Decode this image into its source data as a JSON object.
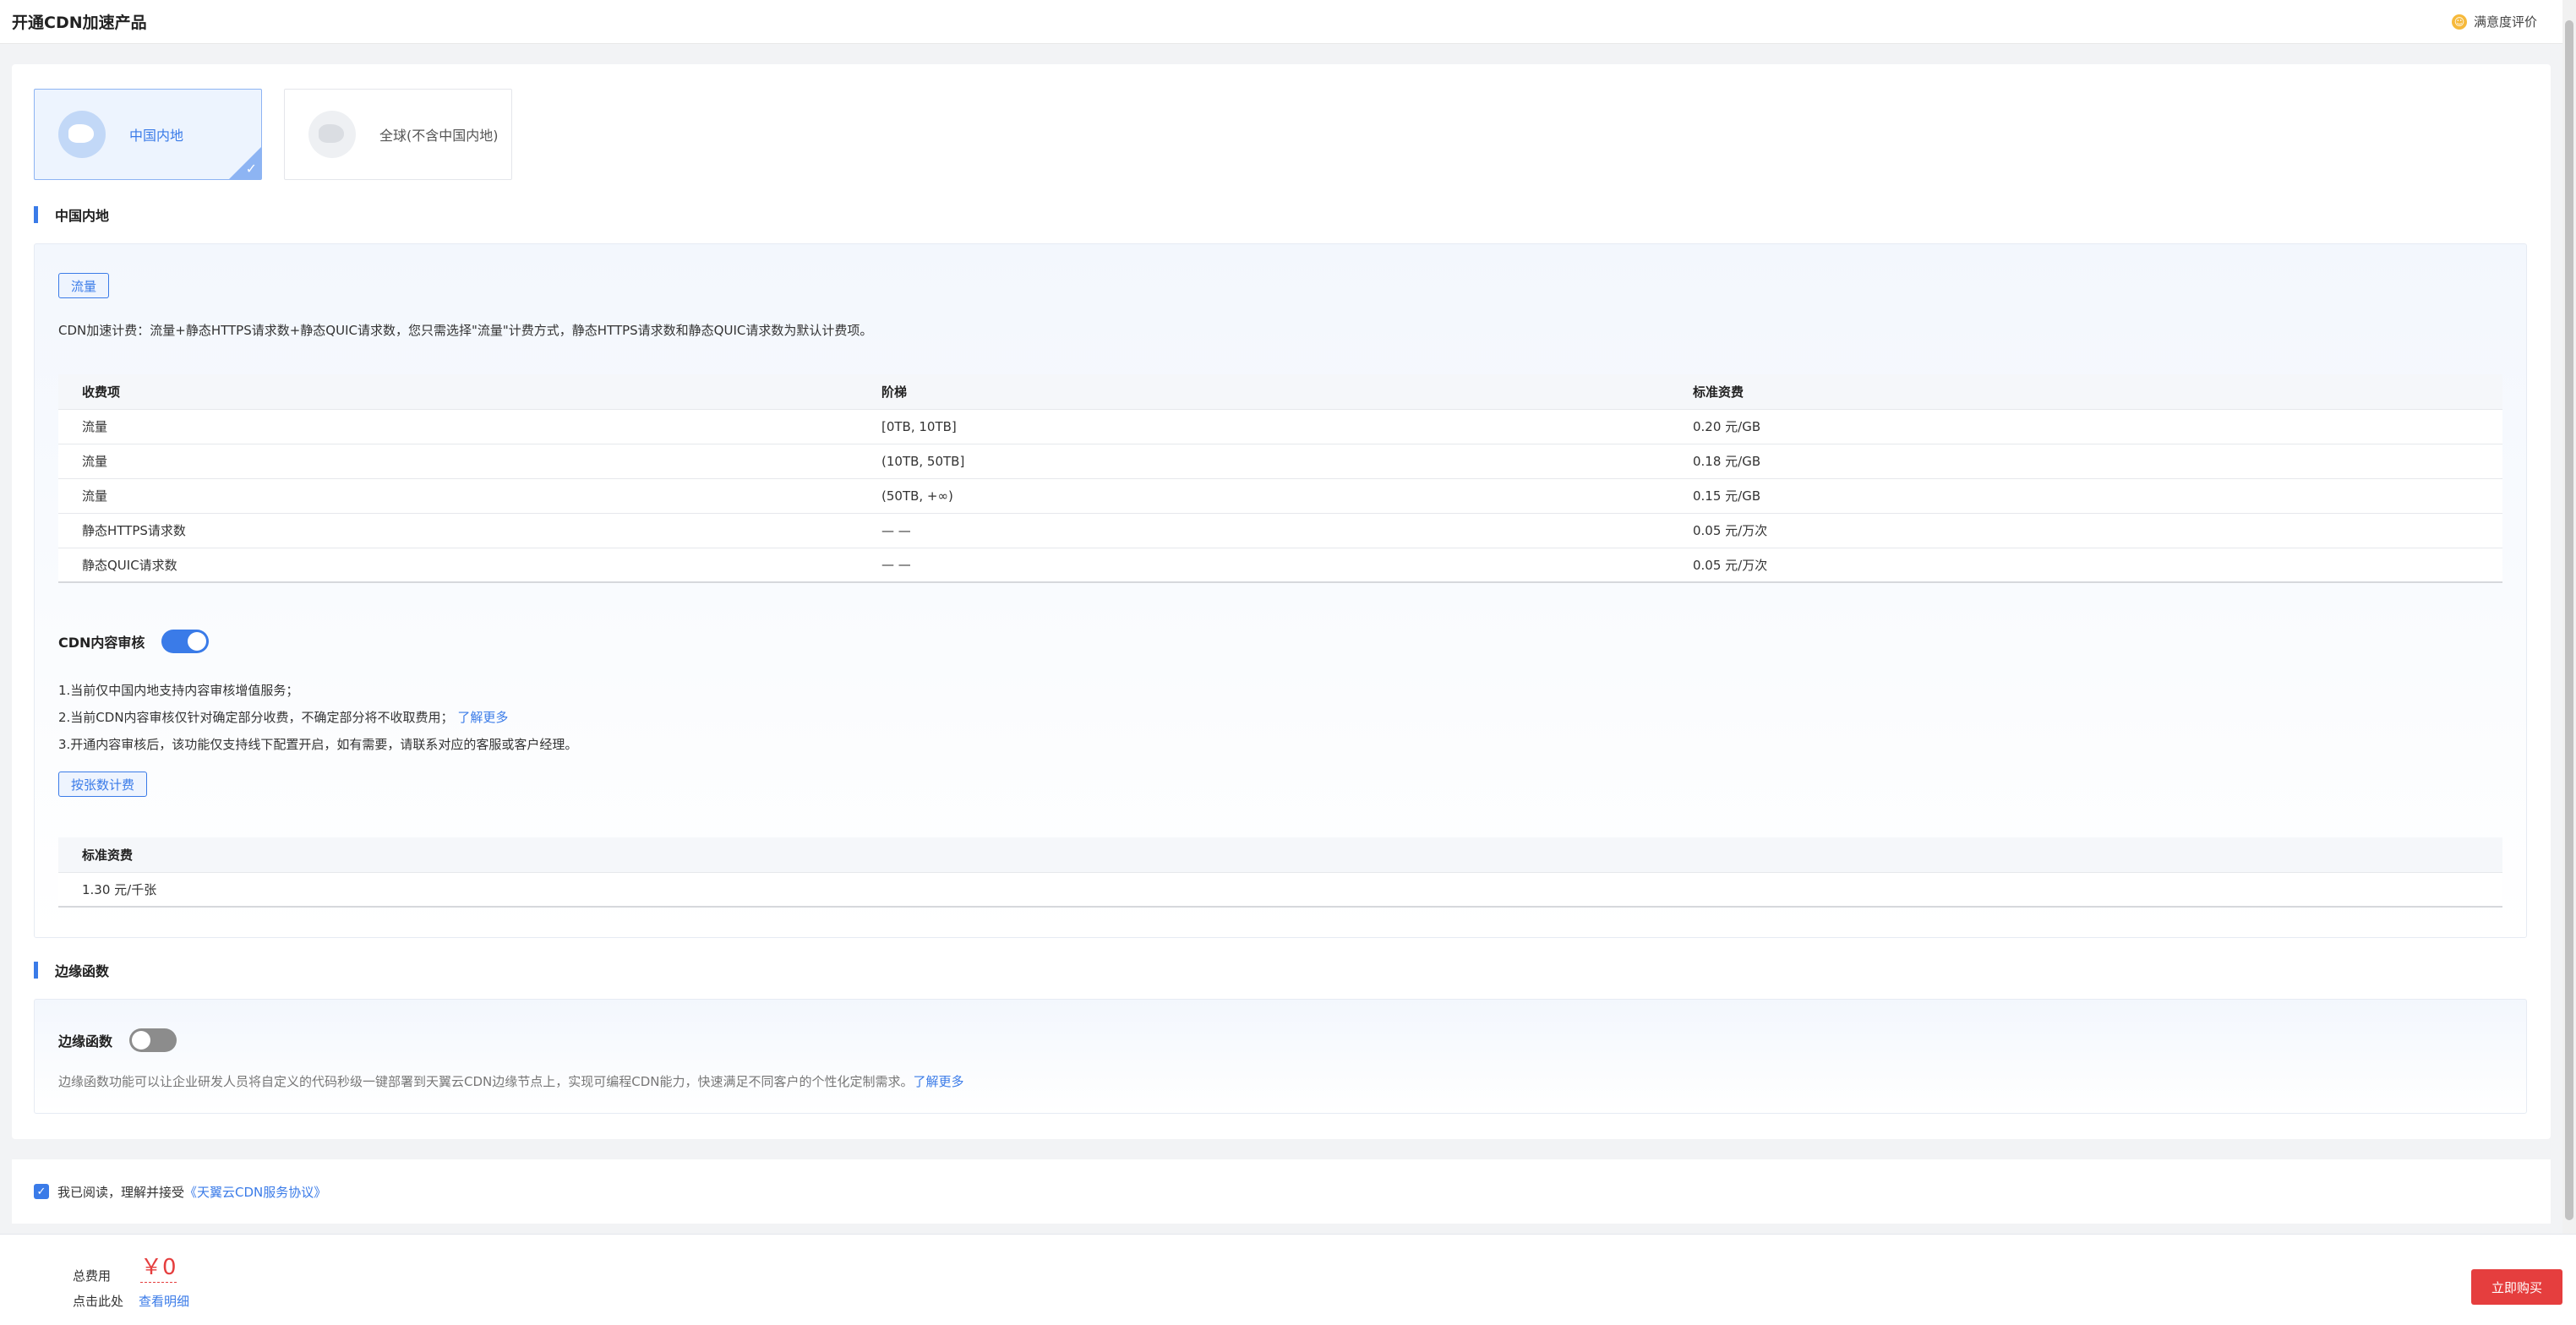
{
  "header": {
    "title": "开通CDN加速产品",
    "survey_label": "满意度评价",
    "survey_icon": "smile-icon"
  },
  "regions": [
    {
      "label": "中国内地",
      "selected": true,
      "icon": "china-map-icon"
    },
    {
      "label": "全球(不含中国内地)",
      "selected": false,
      "icon": "world-map-icon"
    }
  ],
  "mainland": {
    "heading": "中国内地",
    "billing_chip": "流量",
    "billing_desc": "CDN加速计费：流量+静态HTTPS请求数+静态QUIC请求数，您只需选择\"流量\"计费方式，静态HTTPS请求数和静态QUIC请求数为默认计费项。",
    "table": {
      "headers": [
        "收费项",
        "阶梯",
        "标准资费"
      ],
      "rows": [
        [
          "流量",
          "[0TB, 10TB]",
          "0.20 元/GB"
        ],
        [
          "流量",
          "(10TB, 50TB]",
          "0.18 元/GB"
        ],
        [
          "流量",
          "(50TB, +∞)",
          "0.15 元/GB"
        ],
        [
          "静态HTTPS请求数",
          "— —",
          "0.05 元/万次"
        ],
        [
          "静态QUIC请求数",
          "— —",
          "0.05 元/万次"
        ]
      ]
    },
    "audit": {
      "label": "CDN内容审核",
      "enabled": true,
      "notes": [
        "1.当前仅中国内地支持内容审核增值服务；",
        "2.当前CDN内容审核仅针对确定部分收费，不确定部分将不收取费用；",
        "3.开通内容审核后，该功能仅支持线下配置开启，如有需要，请联系对应的客服或客户经理。"
      ],
      "learn_more": "了解更多",
      "billing_chip": "按张数计费",
      "price_header": "标准资费",
      "price_value": "1.30 元/千张"
    }
  },
  "edge": {
    "heading": "边缘函数",
    "label": "边缘函数",
    "enabled": false,
    "desc": "边缘函数功能可以让企业研发人员将自定义的代码秒级一键部署到天翼云CDN边缘节点上，实现可编程CDN能力，快速满足不同客户的个性化定制需求。",
    "learn_more": "了解更多"
  },
  "agreement": {
    "checked": true,
    "prefix": "我已阅读，理解并接受",
    "link": "《天翼云CDN服务协议》"
  },
  "footer": {
    "fee_label": "总费用",
    "fee_value": "￥0",
    "detail_prefix": "点击此处",
    "detail_link": "查看明细",
    "buy_button": "立即购买"
  }
}
